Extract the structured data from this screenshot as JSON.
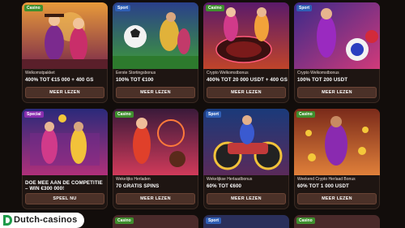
{
  "cards": [
    {
      "badge": "Casino",
      "sub": "Welkomstpakket",
      "title": "400% TOT €15 000 + 400 GS",
      "button": "MEER LEZEN"
    },
    {
      "badge": "Sport",
      "sub": "Eerste Stortingsbonus",
      "title": "100% TOT €100",
      "button": "MEER LEZEN"
    },
    {
      "badge": "Casino",
      "sub": "Crypto Welkomstbonus",
      "title": "400% TOT 20 000 USDT + 400 GS",
      "button": "MEER LEZEN"
    },
    {
      "badge": "Sport",
      "sub": "Crypto Welkomstbonus",
      "title": "100% TOT 200 USDT",
      "button": "MEER LEZEN"
    },
    {
      "badge": "Special",
      "sub": "",
      "title": "DOE MEE AAN DE COMPETITIE – WIN €300 000!",
      "button": "SPEEL NU"
    },
    {
      "badge": "Casino",
      "sub": "Wekelijks Herladen",
      "title": "70 GRATIS SPINS",
      "button": "MEER LEZEN"
    },
    {
      "badge": "Sport",
      "sub": "Wekelijkse Herlaadbonus",
      "title": "60% TOT €600",
      "button": "MEER LEZEN"
    },
    {
      "badge": "Casino",
      "sub": "Weekend Crypto Herlaad Bonus",
      "title": "60% TOT 1 000 USDT",
      "button": "MEER LEZEN"
    }
  ],
  "peek_badges": [
    "Casino",
    "Sport",
    "Casino"
  ],
  "logo": {
    "text": "Dutch-casinos"
  },
  "colors": {
    "casino": "#3f8f2e",
    "sport": "#2f5fb5",
    "special": "#8a2fb0",
    "button": "#4b3128"
  }
}
